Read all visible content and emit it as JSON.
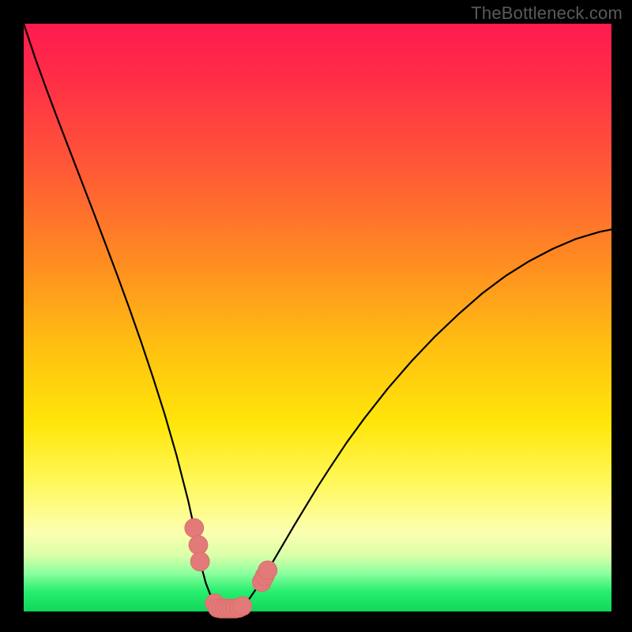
{
  "watermark": {
    "text": "TheBottleneck.com"
  },
  "plot": {
    "inner_x": 30,
    "inner_y": 30,
    "inner_w": 744,
    "inner_h": 744
  },
  "colors": {
    "frame": "#000000",
    "curve": "#000000",
    "marker_stroke": "#de6e6c",
    "marker_fill": "#e17a78",
    "bottom_line": "#1bdc55"
  },
  "gradient_stops": [
    {
      "offset": 0.0,
      "color": "#ff1a4f"
    },
    {
      "offset": 0.1,
      "color": "#ff2f46"
    },
    {
      "offset": 0.25,
      "color": "#ff5a36"
    },
    {
      "offset": 0.4,
      "color": "#ff8a22"
    },
    {
      "offset": 0.55,
      "color": "#ffc011"
    },
    {
      "offset": 0.68,
      "color": "#ffe60a"
    },
    {
      "offset": 0.78,
      "color": "#fff85a"
    },
    {
      "offset": 0.865,
      "color": "#fcffb0"
    },
    {
      "offset": 0.905,
      "color": "#d9ffa8"
    },
    {
      "offset": 0.935,
      "color": "#8cff9e"
    },
    {
      "offset": 0.965,
      "color": "#2aef70"
    },
    {
      "offset": 1.0,
      "color": "#0fd65a"
    }
  ],
  "chart_data": {
    "type": "line",
    "title": "",
    "xlabel": "",
    "ylabel": "",
    "xlim": [
      0,
      100
    ],
    "ylim": [
      0,
      100
    ],
    "x": [
      0,
      2,
      4,
      6,
      8,
      10,
      12,
      14,
      16,
      18,
      20,
      22,
      24,
      26,
      28,
      29,
      30,
      31,
      32,
      33,
      34,
      35,
      36,
      37,
      38,
      40,
      42,
      44,
      46,
      48,
      50,
      52,
      55,
      58,
      62,
      66,
      70,
      74,
      78,
      82,
      86,
      90,
      94,
      98,
      100
    ],
    "y": [
      100,
      94.0,
      88.5,
      83.2,
      78.0,
      72.8,
      67.6,
      62.3,
      57.0,
      51.5,
      45.8,
      39.8,
      33.5,
      26.6,
      18.8,
      14.2,
      8.5,
      4.8,
      2.2,
      0.8,
      0.0,
      0.0,
      0.0,
      0.6,
      1.6,
      4.5,
      7.8,
      11.2,
      14.6,
      17.9,
      21.2,
      24.3,
      28.8,
      32.9,
      38.0,
      42.6,
      46.8,
      50.6,
      54.1,
      57.1,
      59.6,
      61.7,
      63.4,
      64.6,
      65.0
    ],
    "markers": [
      {
        "x": 29.0,
        "y": 14.2,
        "r": 1.6
      },
      {
        "x": 29.7,
        "y": 11.3,
        "r": 1.6
      },
      {
        "x": 30.0,
        "y": 8.5,
        "r": 1.6
      },
      {
        "x": 32.5,
        "y": 1.4,
        "r": 1.6
      },
      {
        "x": 33.0,
        "y": 0.6,
        "r": 1.6
      },
      {
        "x": 33.6,
        "y": 0.5,
        "r": 1.6
      },
      {
        "x": 34.2,
        "y": 0.5,
        "r": 1.6
      },
      {
        "x": 34.8,
        "y": 0.5,
        "r": 1.6
      },
      {
        "x": 35.4,
        "y": 0.5,
        "r": 1.6
      },
      {
        "x": 36.0,
        "y": 0.5,
        "r": 1.6
      },
      {
        "x": 36.6,
        "y": 0.6,
        "r": 1.6
      },
      {
        "x": 37.2,
        "y": 0.9,
        "r": 1.6
      },
      {
        "x": 40.5,
        "y": 5.0,
        "r": 1.6
      },
      {
        "x": 41.0,
        "y": 6.0,
        "r": 1.6
      },
      {
        "x": 41.5,
        "y": 7.0,
        "r": 1.6
      }
    ]
  }
}
